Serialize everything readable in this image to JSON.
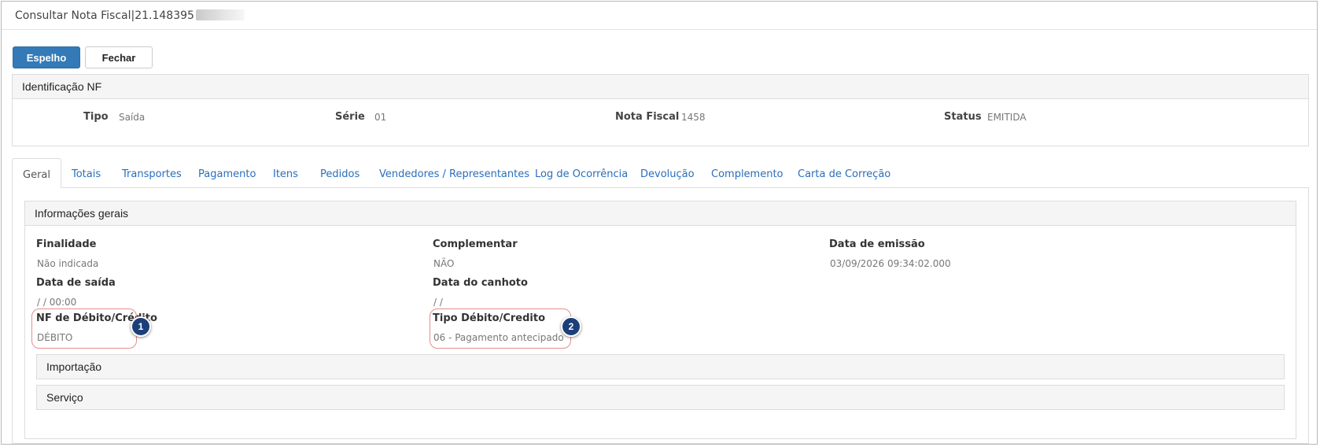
{
  "window": {
    "title": "Consultar Nota Fiscal|21.148395"
  },
  "toolbar": {
    "mirror_label": "Espelho",
    "close_label": "Fechar"
  },
  "identification": {
    "heading": "Identificação NF",
    "fields": [
      {
        "label": "Tipo",
        "value": "Saída"
      },
      {
        "label": "Série",
        "value": "01"
      },
      {
        "label": "Nota Fiscal",
        "value": "1458"
      },
      {
        "label": "Status",
        "value": "EMITIDA"
      }
    ]
  },
  "tabs": [
    {
      "label": "Geral",
      "active": true
    },
    {
      "label": "Totais"
    },
    {
      "label": "Transportes"
    },
    {
      "label": "Pagamento"
    },
    {
      "label": "Itens"
    },
    {
      "label": "Pedidos"
    },
    {
      "label": "Vendedores / Representantes"
    },
    {
      "label": "Log de Ocorrência"
    },
    {
      "label": "Devolução"
    },
    {
      "label": "Complemento"
    },
    {
      "label": "Carta de Correção"
    }
  ],
  "general": {
    "heading": "Informações gerais",
    "fields": [
      {
        "label": "Finalidade",
        "value": "Não indicada"
      },
      {
        "label": "Complementar",
        "value": "NÃO"
      },
      {
        "label": "Data de emissão",
        "value": "03/09/2026 09:34:02.000"
      },
      {
        "label": "Data de saída",
        "value": "/ / 00:00"
      },
      {
        "label": "Data do canhoto",
        "value": "/ /"
      },
      {
        "label": "NF de Débito/Crédito",
        "value": "DÉBITO"
      },
      {
        "label": "Tipo Débito/Credito",
        "value": "06 - Pagamento antecipado"
      }
    ],
    "sections": [
      "Importação",
      "Serviço"
    ]
  },
  "annotations": {
    "badge_1": "1",
    "badge_2": "2"
  },
  "colors": {
    "primary_button": "#337ab7",
    "tab_link": "#2a6ebb",
    "highlight_border": "#e58d8d",
    "badge": "#1c3f7a"
  }
}
